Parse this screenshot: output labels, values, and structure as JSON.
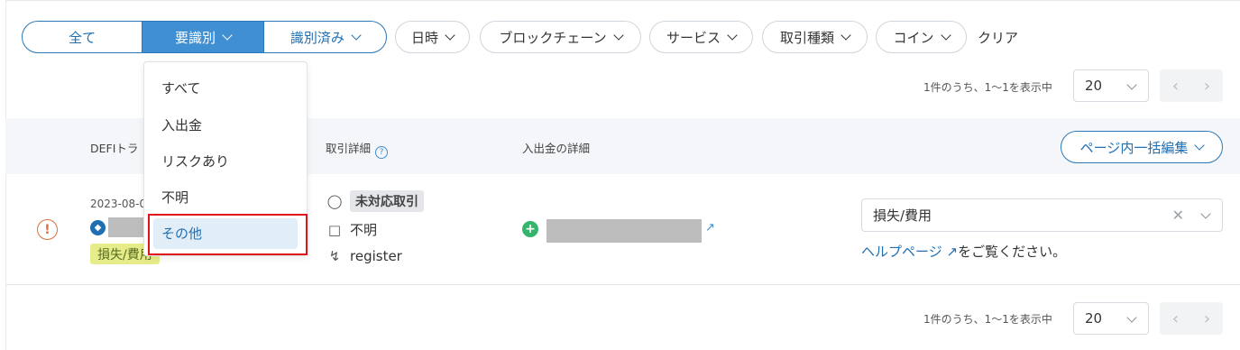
{
  "filters": {
    "segment": [
      "全て",
      "要識別",
      "識別済み"
    ],
    "selected_segment": "要識別",
    "dropdowns": [
      "日時",
      "ブロックチェーン",
      "サービス",
      "取引種類",
      "コイン"
    ],
    "clear_label": "クリア"
  },
  "status_menu": {
    "items": [
      "すべて",
      "入出金",
      "リスクあり",
      "不明",
      "その他"
    ],
    "active": "その他"
  },
  "pagination": {
    "summary": "1件のうち、1〜1を表示中",
    "page_size": "20",
    "prev_icon": "chevron-left-icon",
    "next_icon": "chevron-right-icon"
  },
  "table": {
    "headers": {
      "defi": "DEFIトラ",
      "detail": "取引詳細",
      "transfer": "入出金の詳細"
    },
    "bulk_edit_label": "ページ内一括編集"
  },
  "row": {
    "date": "2023-08-0",
    "tag": "損失/費用",
    "detail_status": "未対応取引",
    "detail_type": "不明",
    "detail_method": "register",
    "category": "損失/費用",
    "help_link": "ヘルプページ",
    "help_suffix": "をご覧ください。"
  },
  "colors": {
    "accent": "#3f8fd2",
    "accent_dark": "#1f6fb2",
    "warning": "#d9703a",
    "success": "#34b56b",
    "highlight_border": "#e0121b",
    "tag_yellow": "#e7ec8a"
  }
}
